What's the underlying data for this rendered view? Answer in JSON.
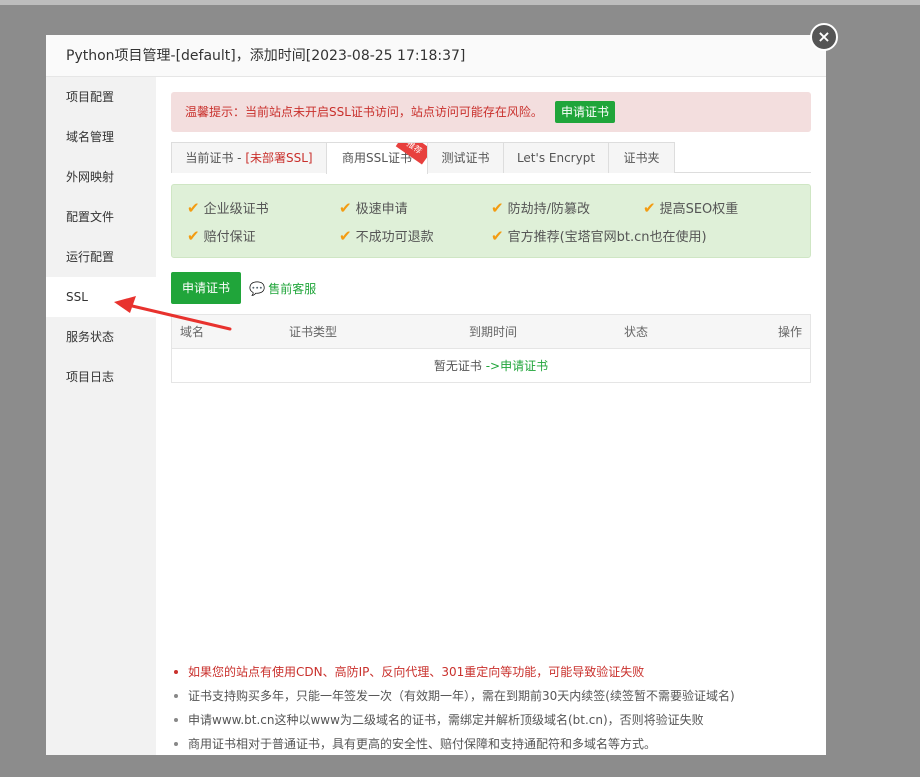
{
  "dialog": {
    "title": "Python项目管理-[default]，添加时间[2023-08-25 17:18:37]",
    "close_icon": "×"
  },
  "sidebar": {
    "items": [
      {
        "label": "项目配置"
      },
      {
        "label": "域名管理"
      },
      {
        "label": "外网映射"
      },
      {
        "label": "配置文件"
      },
      {
        "label": "运行配置"
      },
      {
        "label": "SSL"
      },
      {
        "label": "服务状态"
      },
      {
        "label": "项目日志"
      }
    ],
    "active_index": 5
  },
  "alert": {
    "text": "温馨提示：当前站点未开启SSL证书访问，站点访问可能存在风险。",
    "button": "申请证书"
  },
  "tabs": [
    {
      "label_prefix": "当前证书 - ",
      "label_red": "[未部署SSL]"
    },
    {
      "label": "商用SSL证书",
      "ribbon": "推荐"
    },
    {
      "label": "测试证书"
    },
    {
      "label": "Let's Encrypt"
    },
    {
      "label": "证书夹"
    }
  ],
  "features": [
    "企业级证书",
    "极速申请",
    "防劫持/防篡改",
    "提高SEO权重",
    "赔付保证",
    "不成功可退款",
    "官方推荐(宝塔官网bt.cn也在使用)"
  ],
  "check_glyph": "✔",
  "actions": {
    "apply_button": "申请证书",
    "presale_icon": "💬",
    "presale_label": "售前客服"
  },
  "table": {
    "headers": [
      "域名",
      "证书类型",
      "到期时间",
      "状态",
      "操作"
    ],
    "empty_text": "暂无证书",
    "empty_link": "->申请证书"
  },
  "notes": [
    "如果您的站点有使用CDN、高防IP、反向代理、301重定向等功能，可能导致验证失败",
    "证书支持购买多年，只能一年签发一次（有效期一年），需在到期前30天内续签(续签暂不需要验证域名)",
    "申请www.bt.cn这种以www为二级域名的证书，需绑定并解析顶级域名(bt.cn)，否则将验证失败",
    "商用证书相对于普通证书，具有更高的安全性、赔付保障和支持通配符和多域名等方式。"
  ],
  "colors": {
    "accent": "#20a53a",
    "danger": "#c9302c",
    "check": "#f39c12"
  }
}
